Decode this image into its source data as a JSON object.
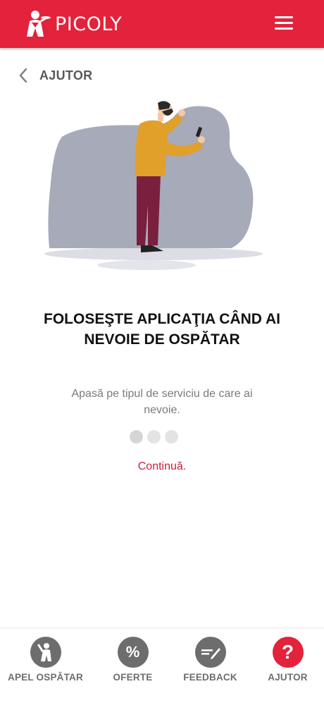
{
  "header": {
    "brand": "PICOLY",
    "logo_icon": "waiter-logo-icon",
    "menu_icon": "hamburger-menu-icon"
  },
  "breadcrumb": {
    "back_icon": "chevron-left-icon",
    "title": "AJUTOR"
  },
  "slide": {
    "headline_line1": "FOLOSEŞTE APLICAŢIA CÂND AI",
    "headline_line2": "NEVOIE DE OSPĂTAR",
    "description_line1": "Apasă pe tipul de serviciu de care ai",
    "description_line2": "nevoie.",
    "total_pages": 3,
    "current_page": 1,
    "continue_label": "Continuă."
  },
  "tabs": [
    {
      "label": "APEL OSPĂTAR",
      "icon": "waiter-call-icon",
      "active": false
    },
    {
      "label": "OFERTE",
      "icon": "percent-icon",
      "glyph": "%",
      "active": false
    },
    {
      "label": "FEEDBACK",
      "icon": "feedback-pen-icon",
      "active": false
    },
    {
      "label": "AJUTOR",
      "icon": "question-icon",
      "glyph": "?",
      "active": true
    }
  ],
  "colors": {
    "brand_red": "#e3223b",
    "link_red": "#c4213a",
    "tab_gray": "#6d6d6d",
    "illustration_blob": "#a7aab9"
  }
}
